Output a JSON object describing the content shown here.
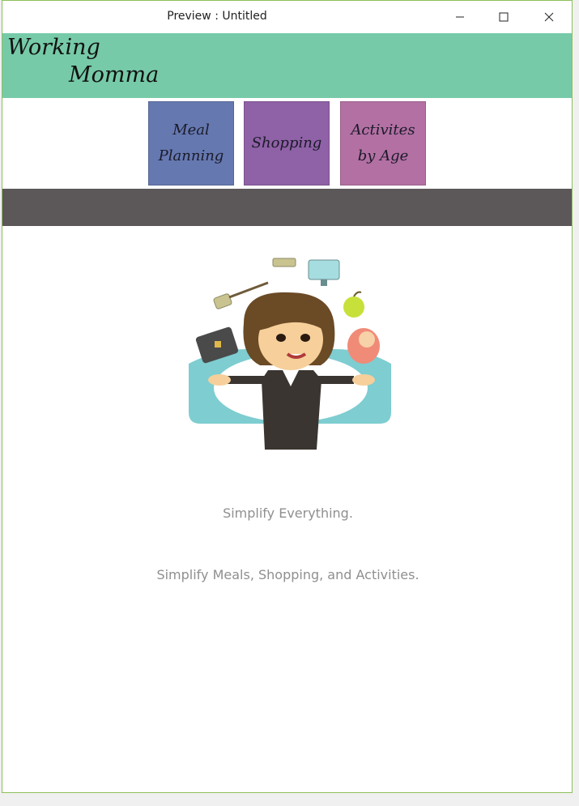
{
  "window": {
    "title": "Preview : Untitled",
    "minimize_icon": "minimize-icon",
    "maximize_icon": "maximize-icon",
    "close_icon": "close-icon"
  },
  "colors": {
    "banner": "#76caa8",
    "meal": "#6578b0",
    "shopping": "#8f61a6",
    "activities": "#b370a3",
    "graybar": "#5c5758",
    "tagline": "#8f8f8f"
  },
  "logo": {
    "line1": "Working",
    "line2": "Momma"
  },
  "nav": {
    "meal_planning": "Meal\nPlanning",
    "shopping": "Shopping",
    "activities": "Activites\nby Age"
  },
  "hero": {
    "illustration": "juggling-mom-illustration"
  },
  "content": {
    "tagline1": "Simplify Everything.",
    "tagline2": "Simplify Meals, Shopping, and Activities."
  }
}
